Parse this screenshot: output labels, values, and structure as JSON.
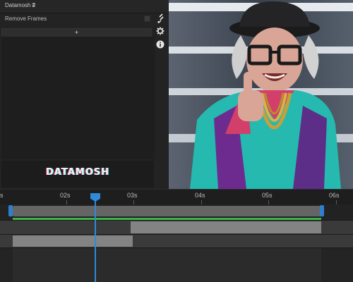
{
  "panel": {
    "title": "Datamosh 2",
    "menu_icon": "hamburger-menu-icon",
    "effect_label": "Remove Frames",
    "add_label": "+",
    "logo_text": "DATAMOSH"
  },
  "timeline": {
    "ticks": [
      "s",
      "02s",
      "03s",
      "04s",
      "05s",
      "06s"
    ],
    "playhead_color": "#2f8ad8",
    "clip_color": "#656565",
    "bar_color": "#3bb34a"
  },
  "video": {
    "description_icon": "video-preview"
  }
}
